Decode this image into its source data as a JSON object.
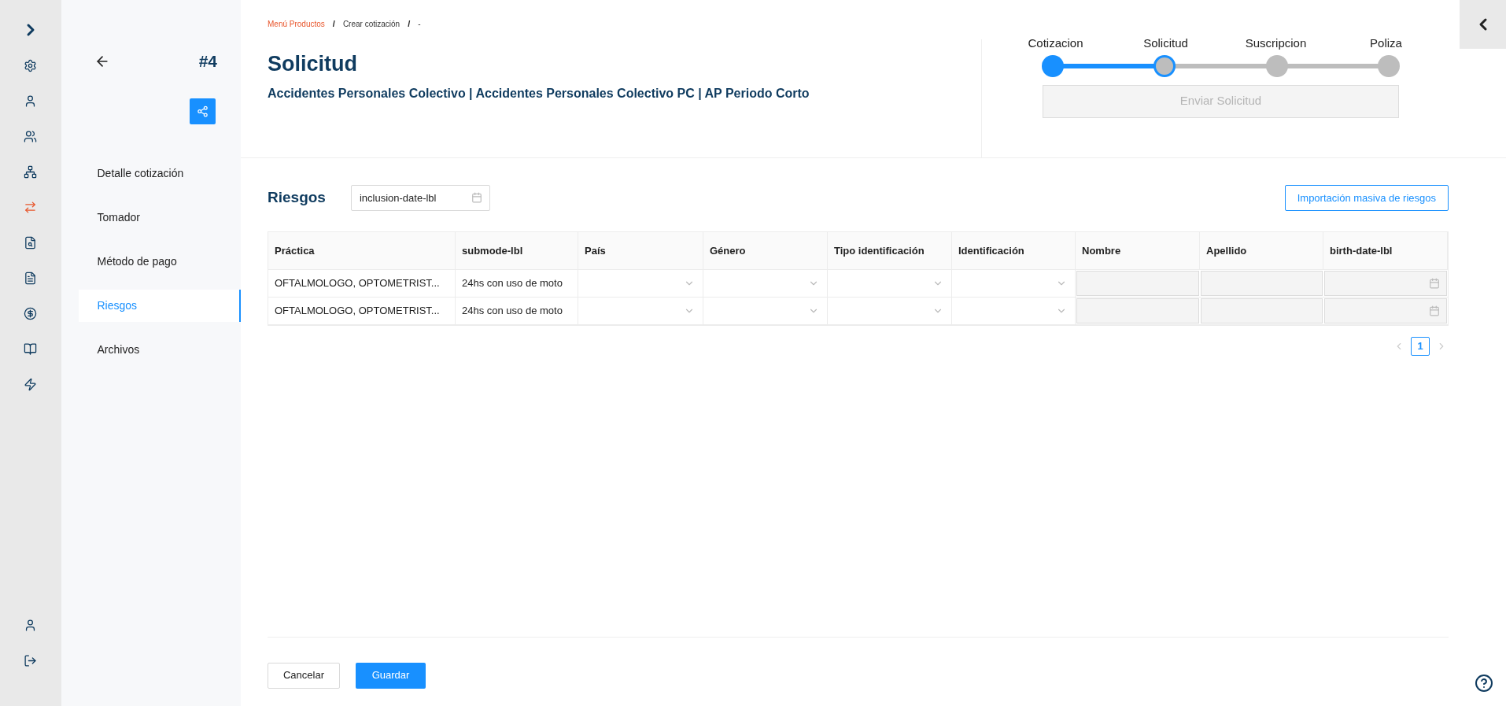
{
  "rail": {
    "top_items": [
      {
        "selected": false
      },
      {
        "selected": false
      },
      {
        "selected": false
      },
      {
        "selected": false
      },
      {
        "selected": true
      },
      {
        "selected": false
      },
      {
        "selected": false
      },
      {
        "selected": false
      },
      {
        "selected": false
      },
      {
        "selected": false
      }
    ],
    "bottom_items": [
      {
        "selected": false
      },
      {
        "selected": false
      }
    ]
  },
  "sidebar": {
    "number": "#4",
    "items": [
      {
        "label": "Detalle cotización",
        "selected": false
      },
      {
        "label": "Tomador",
        "selected": false
      },
      {
        "label": "Método de pago",
        "selected": false
      },
      {
        "label": "Riesgos",
        "selected": true
      },
      {
        "label": "Archivos",
        "selected": false
      }
    ]
  },
  "breadcrumb": [
    {
      "label": "Menú Productos",
      "kind": "link"
    },
    {
      "label": "/",
      "kind": "separator"
    },
    {
      "label": "Crear cotización",
      "kind": "text"
    },
    {
      "label": "/",
      "kind": "separator"
    },
    {
      "label": "-",
      "kind": "text"
    }
  ],
  "title": "Solicitud",
  "subtitle": "Accidentes Personales Colectivo | Accidentes Personales Colectivo PC | AP Periodo Corto",
  "stepper": {
    "steps": [
      {
        "label": "Cotizacion",
        "done": true,
        "selected": false
      },
      {
        "label": "Solicitud",
        "done": false,
        "selected": true
      },
      {
        "label": "Suscripcion",
        "done": false,
        "selected": false
      },
      {
        "label": "Poliza",
        "done": false,
        "selected": false
      }
    ],
    "button": {
      "label": "Enviar Solicitud",
      "disabled": true
    }
  },
  "riesgos": {
    "title": "Riesgos",
    "date_field": {
      "placeholder": "inclusion-date-lbl"
    },
    "import_button": "Importación masiva de riesgos",
    "table": {
      "columns": [
        "Práctica",
        "submode-lbl",
        "País",
        "Género",
        "Tipo identificación",
        "Identificación",
        "Nombre",
        "Apellido",
        "birth-date-lbl"
      ],
      "rows": [
        {
          "cells": [
            {
              "kind": "text",
              "value": "OFTALMOLOGO, OPTOMETRIST..."
            },
            {
              "kind": "text",
              "value": "24hs con uso de moto"
            },
            {
              "kind": "select"
            },
            {
              "kind": "select"
            },
            {
              "kind": "select"
            },
            {
              "kind": "select"
            },
            {
              "kind": "input"
            },
            {
              "kind": "input"
            },
            {
              "kind": "date"
            }
          ]
        },
        {
          "cells": [
            {
              "kind": "text",
              "value": "OFTALMOLOGO, OPTOMETRIST..."
            },
            {
              "kind": "text",
              "value": "24hs con uso de moto"
            },
            {
              "kind": "select"
            },
            {
              "kind": "select"
            },
            {
              "kind": "select"
            },
            {
              "kind": "select"
            },
            {
              "kind": "input"
            },
            {
              "kind": "input"
            },
            {
              "kind": "date"
            }
          ]
        }
      ]
    },
    "pagination": {
      "pages": [
        {
          "label": "1",
          "selected": true
        }
      ]
    }
  },
  "footer": {
    "cancel": "Cancelar",
    "save": "Guardar"
  }
}
